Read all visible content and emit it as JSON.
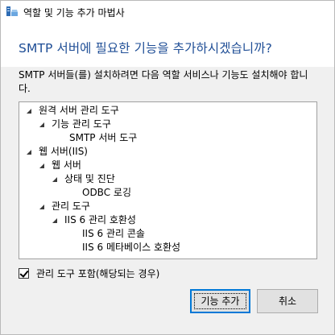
{
  "window": {
    "title": "역할 및 기능 추가 마법사",
    "icon": "server-manager-icon"
  },
  "heading": "SMTP 서버에 필요한 기능을 추가하시겠습니까?",
  "description": "SMTP 서버들(를) 설치하려면 다음 역할 서비스나 기능도 설치해야 합니다.",
  "tree": [
    {
      "label": "원격 서버 관리 도구",
      "toggle": true
    },
    {
      "label": "기능 관리 도구",
      "toggle": true
    },
    {
      "label": "SMTP 서버 도구",
      "toggle": false
    },
    {
      "label": "웹 서버(IIS)",
      "toggle": true
    },
    {
      "label": "웹 서버",
      "toggle": true
    },
    {
      "label": "상태 및 진단",
      "toggle": true
    },
    {
      "label": "ODBC 로깅",
      "toggle": false
    },
    {
      "label": "관리 도구",
      "toggle": true
    },
    {
      "label": "IIS 6 관리 호환성",
      "toggle": true
    },
    {
      "label": "IIS 6 관리 콘솔",
      "toggle": false
    },
    {
      "label": "IIS 6 메타베이스 호환성",
      "toggle": false
    }
  ],
  "include_tools": {
    "label": "관리 도구 포함(해당되는 경우)",
    "checked": true
  },
  "buttons": {
    "add": "기능 추가",
    "cancel": "취소"
  },
  "colors": {
    "heading": "#1f4e96",
    "focus_border": "#0078d7"
  }
}
